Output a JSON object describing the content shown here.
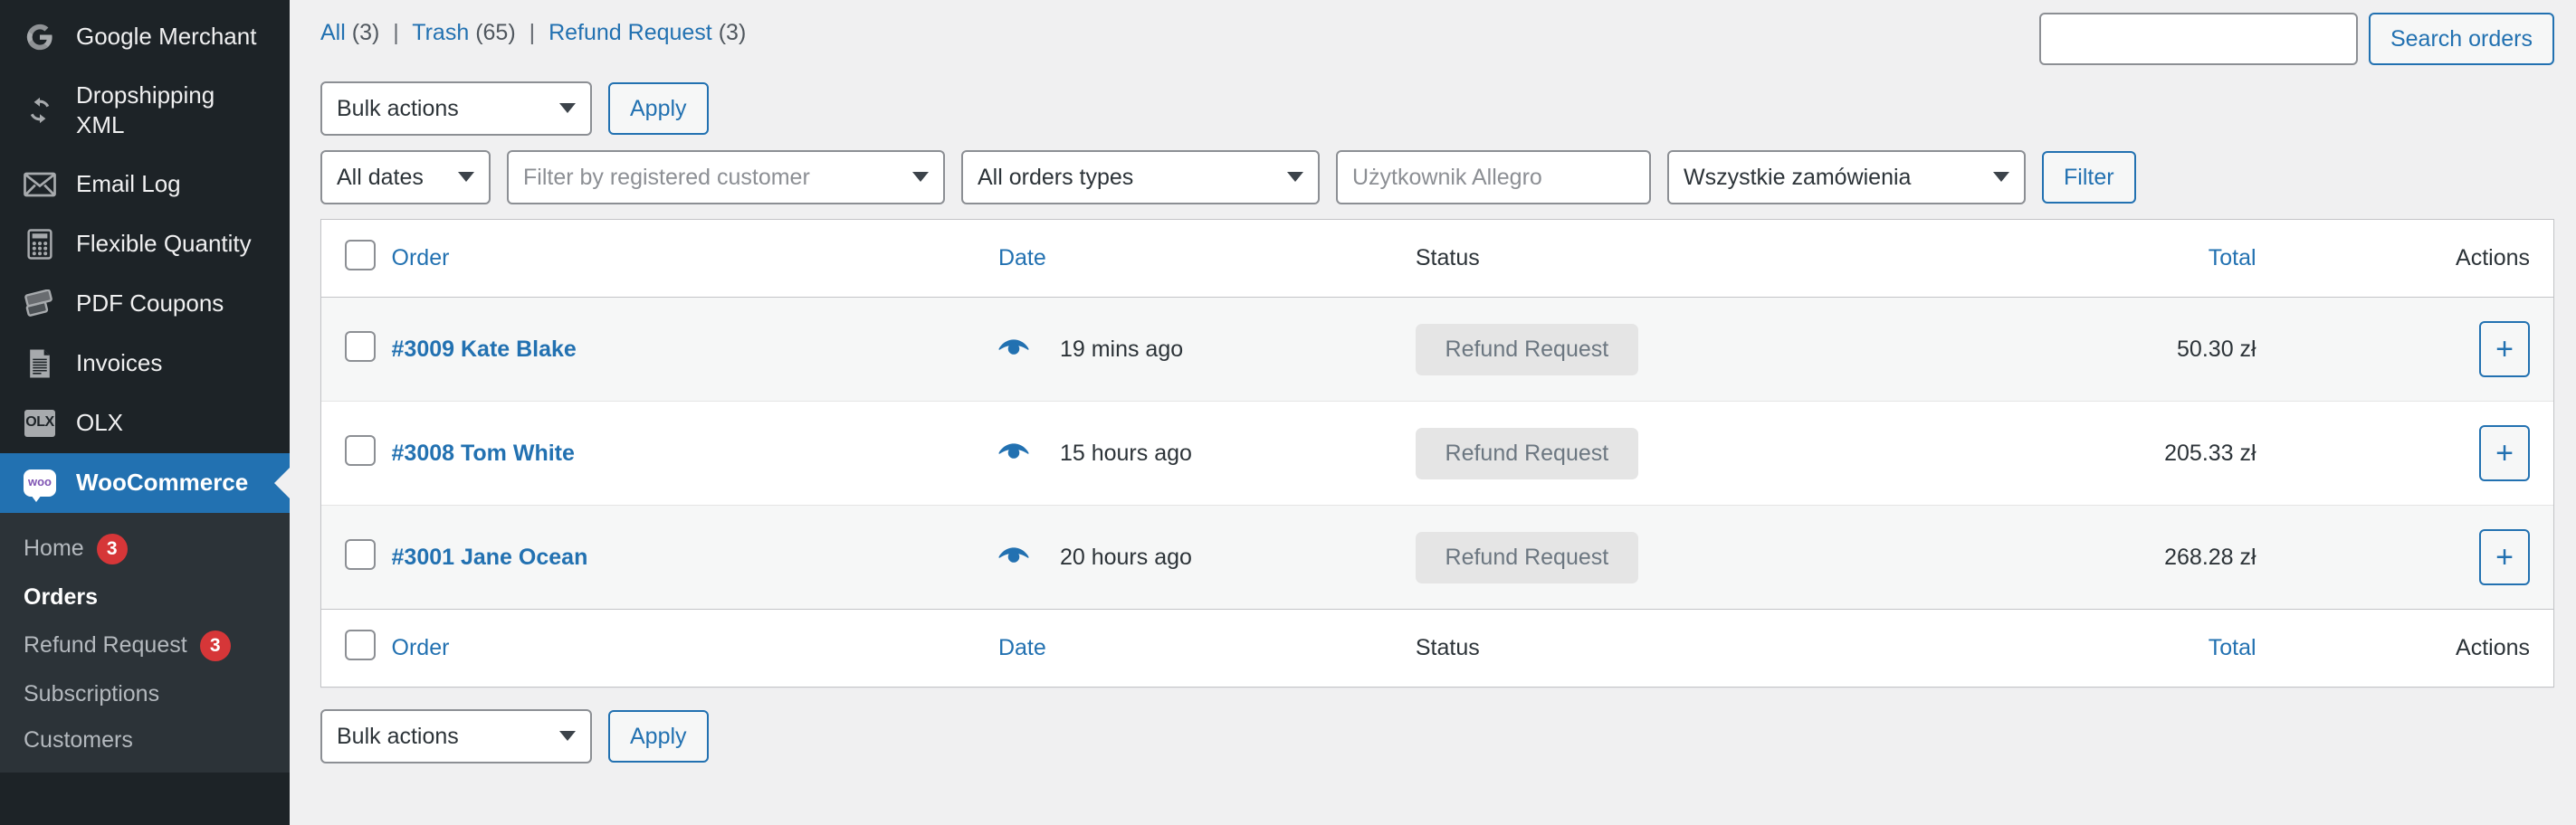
{
  "sidebar": {
    "items": [
      {
        "label": "Google Merchant",
        "icon": "google-icon"
      },
      {
        "label": "Dropshipping\nXML",
        "icon": "sync-icon"
      },
      {
        "label": "Email Log",
        "icon": "envelope-icon"
      },
      {
        "label": "Flexible Quantity",
        "icon": "calculator-icon"
      },
      {
        "label": "PDF Coupons",
        "icon": "tickets-icon"
      },
      {
        "label": "Invoices",
        "icon": "document-icon"
      },
      {
        "label": "OLX",
        "icon": "olx-icon",
        "icon_text": "OLX"
      },
      {
        "label": "WooCommerce",
        "icon": "woocommerce-icon",
        "icon_text": "woo",
        "current": true
      }
    ],
    "submenu": [
      {
        "label": "Home",
        "badge": "3"
      },
      {
        "label": "Orders",
        "active": true
      },
      {
        "label": "Refund Request",
        "badge": "3"
      },
      {
        "label": "Subscriptions"
      },
      {
        "label": "Customers"
      }
    ]
  },
  "views": {
    "all_label": "All",
    "all_count": "(3)",
    "trash_label": "Trash",
    "trash_count": "(65)",
    "refund_label": "Refund Request",
    "refund_count": "(3)",
    "separator": "|"
  },
  "search": {
    "value": "",
    "placeholder": "",
    "button_label": "Search orders"
  },
  "toolbar_top": {
    "bulk_actions_label": "Bulk actions",
    "apply_label": "Apply"
  },
  "toolbar_bottom": {
    "bulk_actions_label": "Bulk actions",
    "apply_label": "Apply"
  },
  "filters": {
    "dates_label": "All dates",
    "customer_placeholder": "Filter by registered customer",
    "order_types_label": "All orders types",
    "allegro_user_placeholder": "Użytkownik Allegro",
    "allegro_user_value": "",
    "allegro_orders_label": "Wszystkie zamówienia",
    "filter_button_label": "Filter"
  },
  "table": {
    "columns": {
      "order": "Order",
      "date": "Date",
      "status": "Status",
      "total": "Total",
      "actions": "Actions"
    },
    "rows": [
      {
        "order": "#3009 Kate Blake",
        "date": "19 mins ago",
        "status": "Refund Request",
        "total": "50.30 zł",
        "action_icon": "plus-icon",
        "preview_icon": "eye-icon"
      },
      {
        "order": "#3008 Tom White",
        "date": "15 hours ago",
        "status": "Refund Request",
        "total": "205.33 zł",
        "action_icon": "plus-icon",
        "preview_icon": "eye-icon"
      },
      {
        "order": "#3001 Jane Ocean",
        "date": "20 hours ago",
        "status": "Refund Request",
        "total": "268.28 zł",
        "action_icon": "plus-icon",
        "preview_icon": "eye-icon"
      }
    ]
  },
  "colors": {
    "accent": "#2271b1",
    "sidebar_bg": "#1d2327",
    "submenu_bg": "#2c3338",
    "badge": "#d63638",
    "page_bg": "#f0f0f1",
    "status_pill_bg": "#e5e5e5"
  },
  "plus_glyph": "+"
}
